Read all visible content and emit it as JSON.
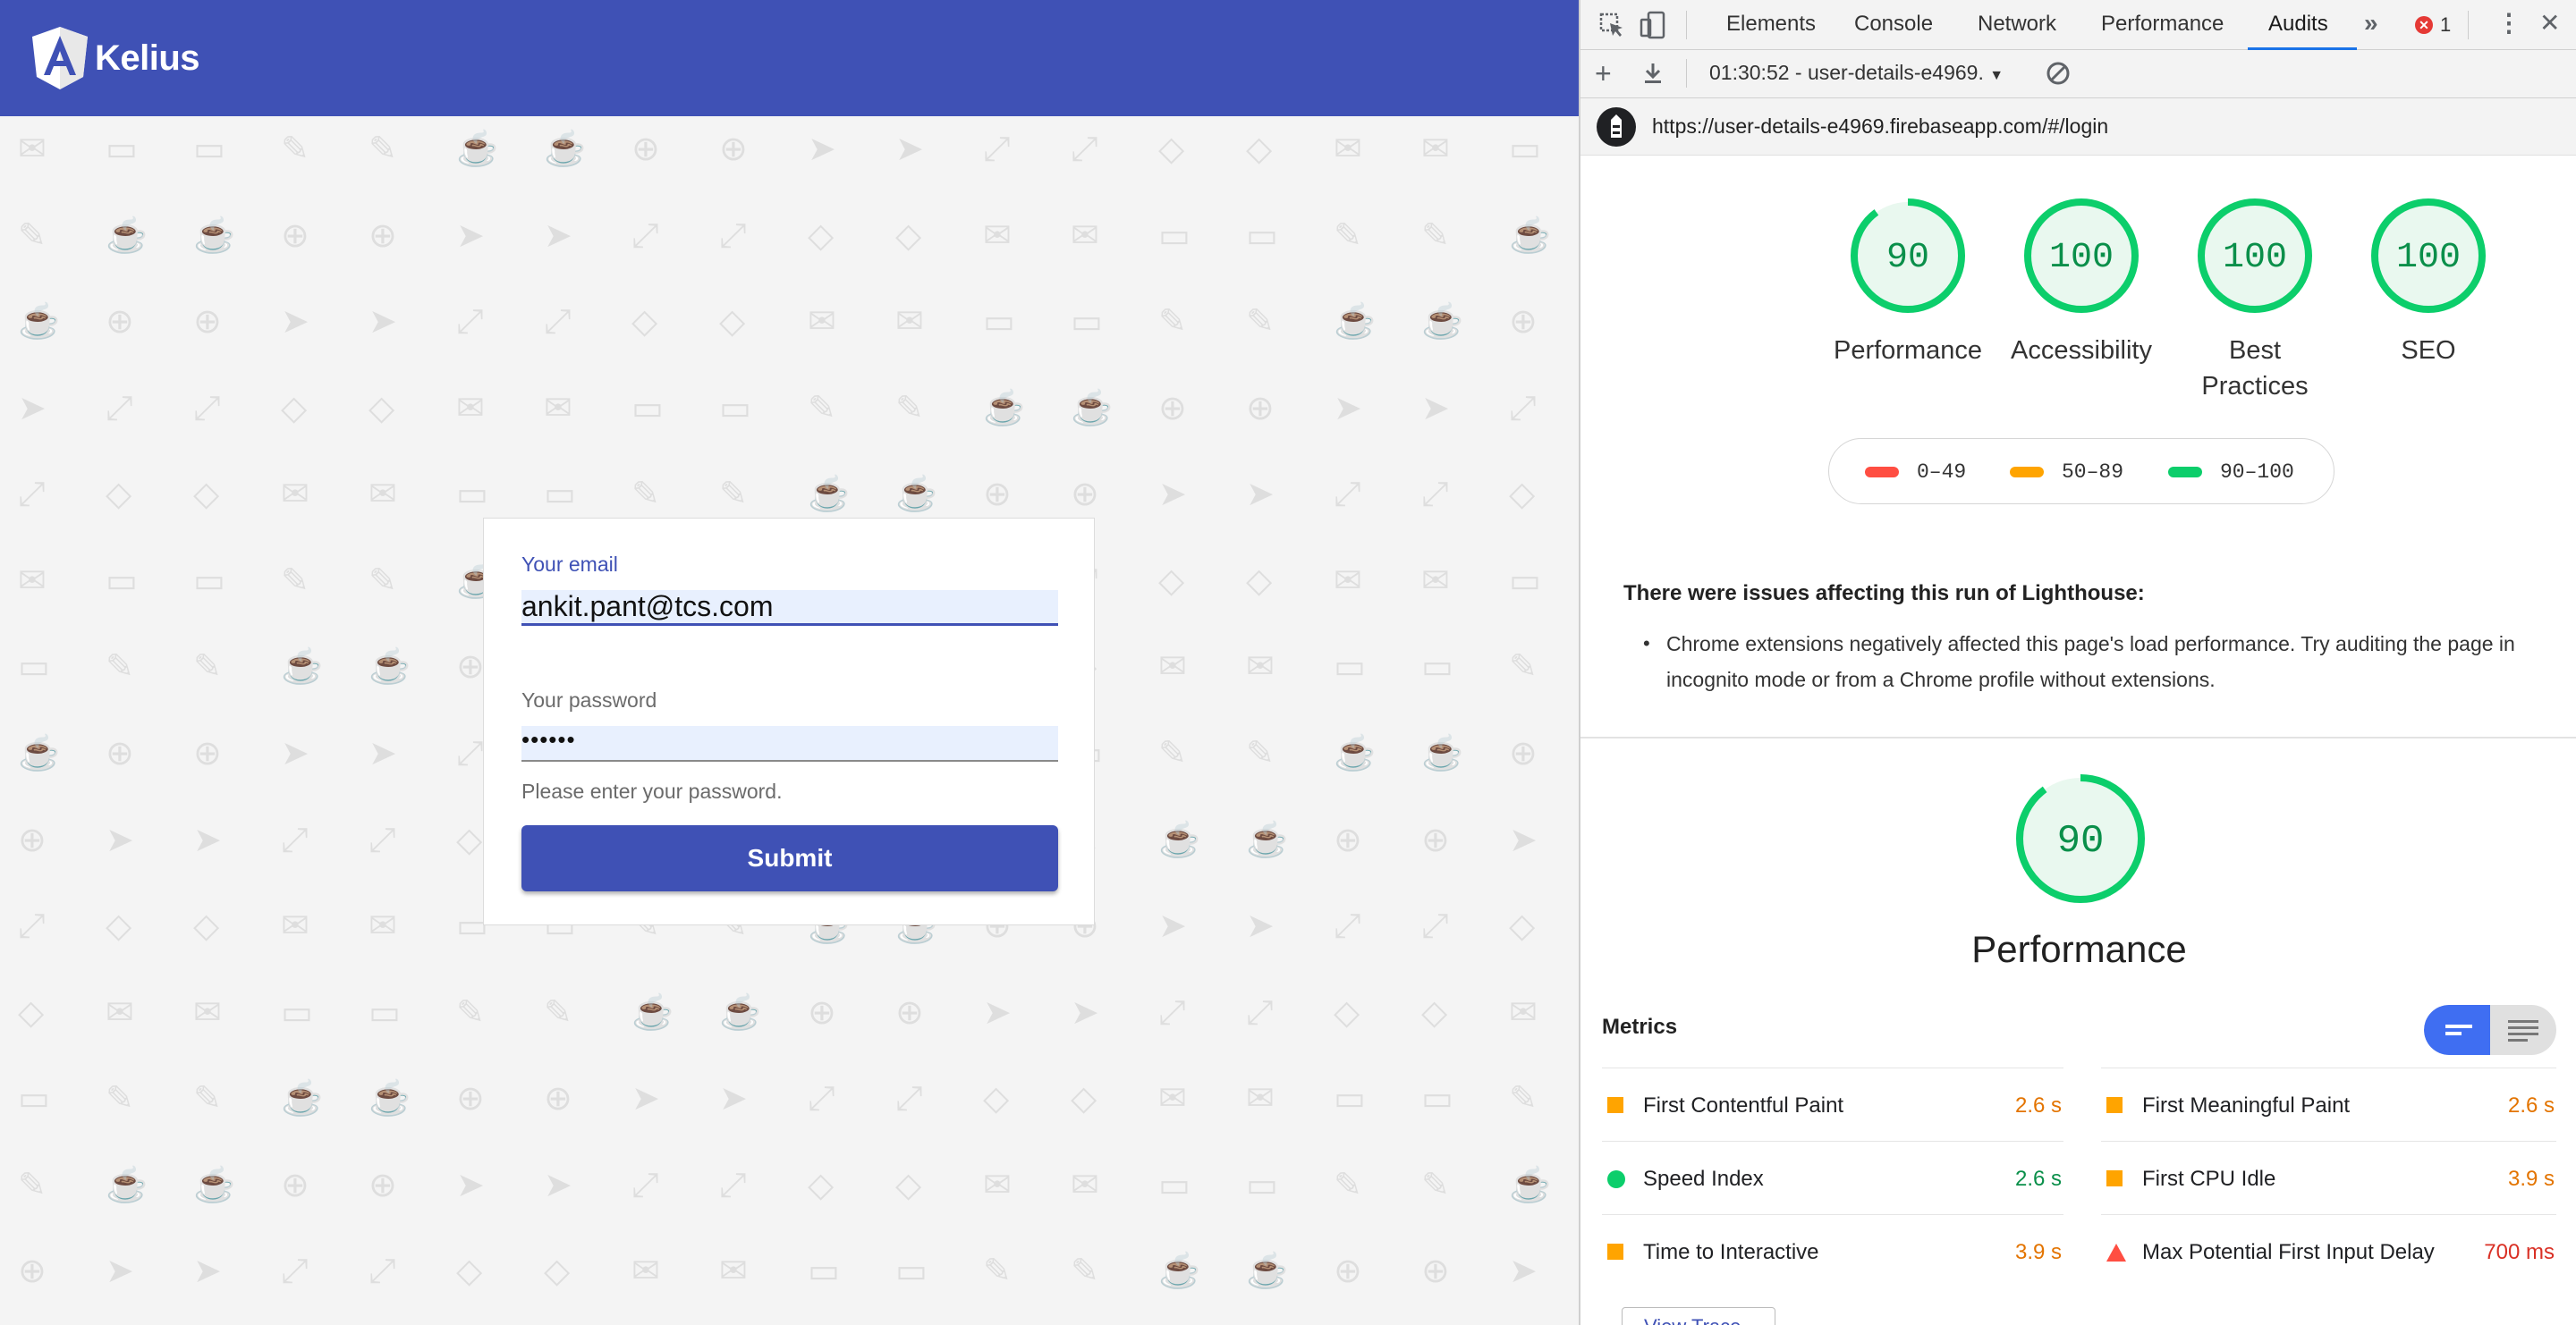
{
  "app": {
    "brand": "Kelius",
    "colors": {
      "primary": "#3f51b5",
      "background": "#f4f4f4"
    },
    "login": {
      "email_label": "Your email",
      "email_value": "ankit.pant@tcs.com",
      "password_label": "Your password",
      "password_value": "••••••",
      "password_hint": "Please enter your password.",
      "submit_label": "Submit"
    }
  },
  "devtools": {
    "tabs": [
      "Elements",
      "Console",
      "Network",
      "Performance",
      "Audits"
    ],
    "active_tab": "Audits",
    "more_tabs_icon": "»",
    "error_count": "1",
    "report_select": "01:30:52 - user-details-e4969.",
    "url": "https://user-details-e4969.firebaseapp.com/#/login",
    "scores": [
      {
        "label": "Performance",
        "value": "90"
      },
      {
        "label": "Accessibility",
        "value": "100"
      },
      {
        "label": "Best Practices",
        "value": "100"
      },
      {
        "label": "SEO",
        "value": "100"
      }
    ],
    "legend": [
      {
        "range": "0–49",
        "color": "#ff4e42"
      },
      {
        "range": "50–89",
        "color": "#ffa400"
      },
      {
        "range": "90–100",
        "color": "#0cce6b"
      }
    ],
    "issues": {
      "title": "There were issues affecting this run of Lighthouse:",
      "items": [
        "Chrome extensions negatively affected this page's load performance. Try auditing the page in incognito mode or from a Chrome profile without extensions."
      ]
    },
    "category": {
      "label": "Performance",
      "value": "90"
    },
    "metrics": {
      "title": "Metrics",
      "left": [
        {
          "name": "First Contentful Paint",
          "value": "2.6 s",
          "status": "average"
        },
        {
          "name": "Speed Index",
          "value": "2.6 s",
          "status": "pass"
        },
        {
          "name": "Time to Interactive",
          "value": "3.9 s",
          "status": "average"
        }
      ],
      "right": [
        {
          "name": "First Meaningful Paint",
          "value": "2.6 s",
          "status": "average"
        },
        {
          "name": "First CPU Idle",
          "value": "3.9 s",
          "status": "average"
        },
        {
          "name": "Max Potential First Input Delay",
          "value": "700 ms",
          "status": "fail"
        }
      ]
    },
    "view_treemap_label": "View Trace",
    "status_colors": {
      "pass": "#0cce6b",
      "average": "#ffa400",
      "fail": "#ff4e42",
      "pass_text": "#0a8f4a",
      "average_text": "#e37400",
      "fail_text": "#d93025"
    }
  }
}
